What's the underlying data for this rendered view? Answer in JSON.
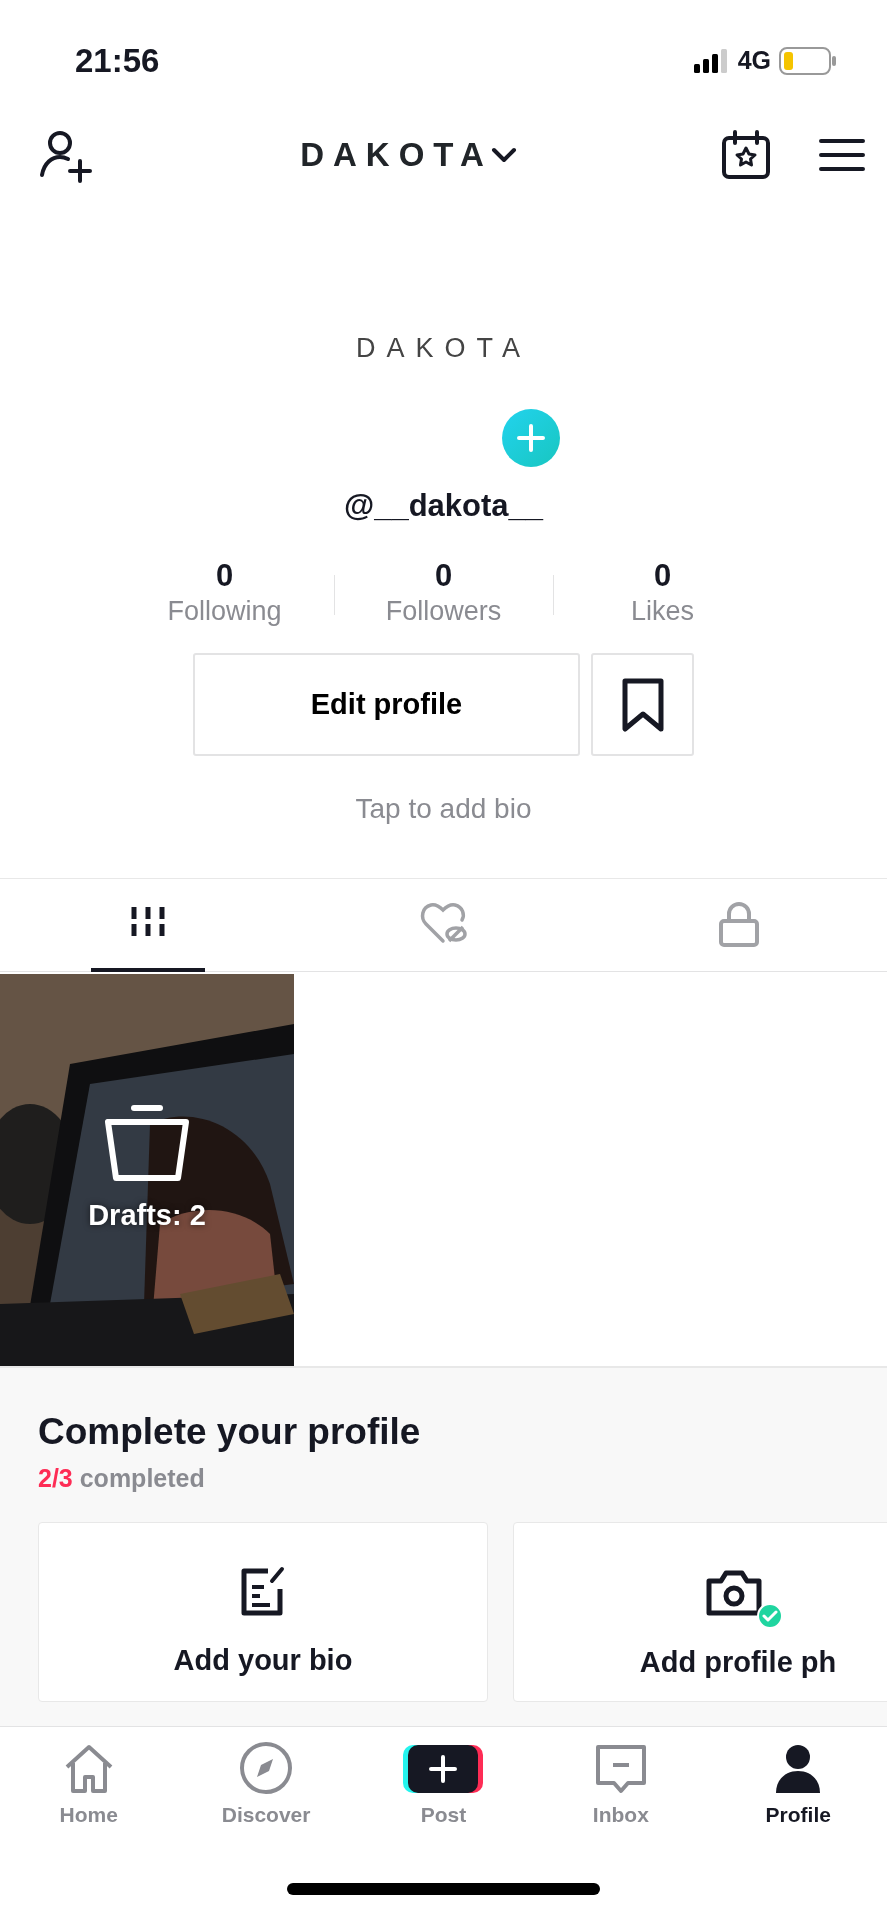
{
  "status_bar": {
    "time": "21:56",
    "network": "4G"
  },
  "header": {
    "title": "DAKOTA"
  },
  "profile": {
    "display_name": "DAKOTA",
    "handle": "@__dakota__",
    "stats": [
      {
        "value": "0",
        "label": "Following"
      },
      {
        "value": "0",
        "label": "Followers"
      },
      {
        "value": "0",
        "label": "Likes"
      }
    ],
    "edit_button": "Edit profile",
    "bio_placeholder": "Tap to add bio"
  },
  "tabs": [
    {
      "kind": "videos",
      "selected": true
    },
    {
      "kind": "liked",
      "selected": false
    },
    {
      "kind": "private",
      "selected": false
    }
  ],
  "grid": [
    {
      "kind": "drafts",
      "label": "Drafts: 2"
    }
  ],
  "complete_profile": {
    "title": "Complete your profile",
    "progress": "2/3",
    "progress_label": "completed",
    "cards": [
      {
        "kind": "bio",
        "title": "Add your bio",
        "completed": false
      },
      {
        "title": "Add profile ph",
        "completed": true
      }
    ]
  },
  "bottom_nav": [
    {
      "kind": "home",
      "label": "Home",
      "selected": false
    },
    {
      "kind": "discover",
      "label": "Discover",
      "selected": false
    },
    {
      "kind": "post",
      "label": "Post",
      "selected": false
    },
    {
      "kind": "inbox",
      "label": "Inbox",
      "selected": false
    },
    {
      "kind": "profile",
      "label": "Profile",
      "selected": true
    }
  ]
}
